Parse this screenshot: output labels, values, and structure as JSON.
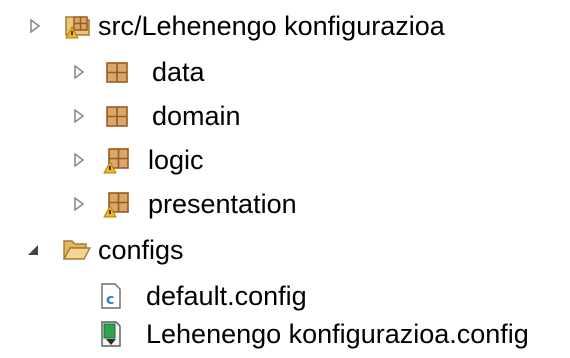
{
  "tree": {
    "items": [
      {
        "label": "src/Lehenengo konfigurazioa",
        "icon": "package-folder-warning-icon",
        "expanded": false
      },
      {
        "label": "data",
        "icon": "package-icon",
        "expanded": false
      },
      {
        "label": "domain",
        "icon": "package-icon",
        "expanded": false
      },
      {
        "label": "logic",
        "icon": "package-warning-icon",
        "expanded": false
      },
      {
        "label": "presentation",
        "icon": "package-warning-icon",
        "expanded": false
      },
      {
        "label": "configs",
        "icon": "folder-open-icon",
        "expanded": true
      },
      {
        "label": "default.config",
        "icon": "config-file-icon"
      },
      {
        "label": "Lehenengo konfigurazioa.config",
        "icon": "launch-config-file-icon"
      }
    ]
  },
  "colors": {
    "package_fill": "#d9a76a",
    "package_stroke": "#9a5a1e",
    "warning": "#f2b624",
    "folder": "#e9c77a",
    "file_blue": "#2e7bd1",
    "launch_green": "#2fa44f"
  }
}
